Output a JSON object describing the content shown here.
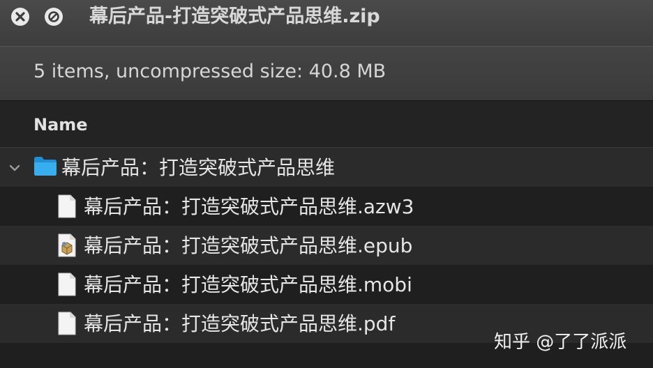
{
  "window": {
    "title": "幕后产品-打造突破式产品思维.zip"
  },
  "info": {
    "summary": "5 items, uncompressed size: 40.8 MB"
  },
  "columns": {
    "name": "Name"
  },
  "files": [
    {
      "label": "幕后产品：打造突破式产品思维",
      "icon": "folder-icon"
    },
    {
      "label": "幕后产品：打造突破式产品思维.azw3",
      "icon": "document-icon"
    },
    {
      "label": "幕后产品：打造突破式产品思维.epub",
      "icon": "epub-file-icon"
    },
    {
      "label": "幕后产品：打造突破式产品思维.mobi",
      "icon": "document-icon"
    },
    {
      "label": "幕后产品：打造突破式产品思维.pdf",
      "icon": "document-icon"
    }
  ],
  "watermark": {
    "text": "知乎 @了了派派"
  },
  "colors": {
    "folder": "#29a3e6",
    "background": "#1f1f1f",
    "alt_row": "#2b2b2b"
  }
}
